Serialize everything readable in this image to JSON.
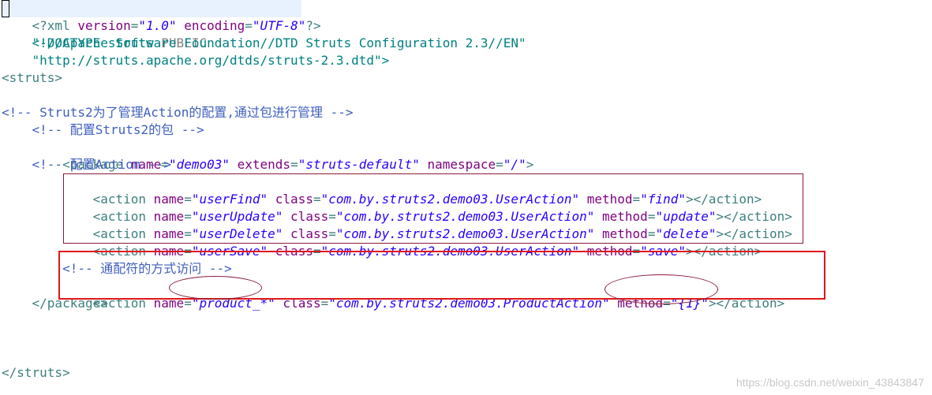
{
  "code": {
    "l1": {
      "open": "<?xml ",
      "a1": "version",
      "eq1": "=",
      "v1": "\"1.0\"",
      "sp": " ",
      "a2": "encoding",
      "eq2": "=",
      "v2": "\"UTF-8\"",
      "close": "?>"
    },
    "l2": {
      "open": "<!DOCTYPE ",
      "name": "struts",
      "kw": " PUBLIC"
    },
    "l3": {
      "text": "    \"-//Apache Software Foundation//DTD Struts Configuration 2.3//EN\""
    },
    "l4": {
      "text": "    \"http://struts.apache.org/dtds/struts-2.3.dtd\">"
    },
    "l5": {
      "text": "<struts>"
    },
    "l7": {
      "text": "<!-- Struts2为了管理Action的配置,通过包进行管理 -->"
    },
    "l8": {
      "text": "    <!-- 配置Struts2的包 -->"
    },
    "l9": {
      "open": "    <package ",
      "a1": "name",
      "eq": "=",
      "v1": "\"demo03\"",
      "a2": " extends",
      "v2": "\"struts-default\"",
      "a3": " namespace",
      "v3": "\"/\"",
      "close": ">"
    },
    "l10": {
      "text": "    <!-- 配置Action -->"
    },
    "l11": {
      "open": "        <action ",
      "a1": "name",
      "v1": "\"userFind\"",
      "a2": " class",
      "v2": "\"com.by.struts2.demo03.UserAction\"",
      "a3": " method",
      "v3": "\"find\"",
      "close": "></action>"
    },
    "l12": {
      "open": "        <action ",
      "a1": "name",
      "v1": "\"userUpdate\"",
      "a2": " class",
      "v2": "\"com.by.struts2.demo03.UserAction\"",
      "a3": " method",
      "v3": "\"update\"",
      "close": "></action>"
    },
    "l13": {
      "open": "        <action ",
      "a1": "name",
      "v1": "\"userDelete\"",
      "a2": " class",
      "v2": "\"com.by.struts2.demo03.UserAction\"",
      "a3": " method",
      "v3": "\"delete\"",
      "close": "></action>"
    },
    "l14": {
      "open": "        <action ",
      "a1": "name",
      "v1": "\"userSave\"",
      "a2": " class",
      "v2": "\"com.by.struts2.demo03.UserAction\"",
      "a3": " method",
      "v3": "\"save\"",
      "close": "></action>"
    },
    "l16": {
      "text": "        <!-- 通配符的方式访问 -->"
    },
    "l17": {
      "open": "        <action ",
      "a1": "name",
      "v1": "\"product_*\"",
      "a2": " class",
      "v2": "\"com.by.struts2.demo03.ProductAction\"",
      "a3": " method",
      "v3": "\"{1}\"",
      "close": "></action>"
    },
    "l18": {
      "text": "    </package>"
    },
    "l22": {
      "text": "</struts>"
    }
  },
  "watermark": "https://blog.csdn.net/weixin_43843847",
  "colors": {
    "tag": "#3f7f7f",
    "attr": "#7f007f",
    "value": "#2a00ff",
    "comment": "#3f5fbf",
    "box_dark": "#8b1a3a",
    "box_red": "#e0161a"
  }
}
